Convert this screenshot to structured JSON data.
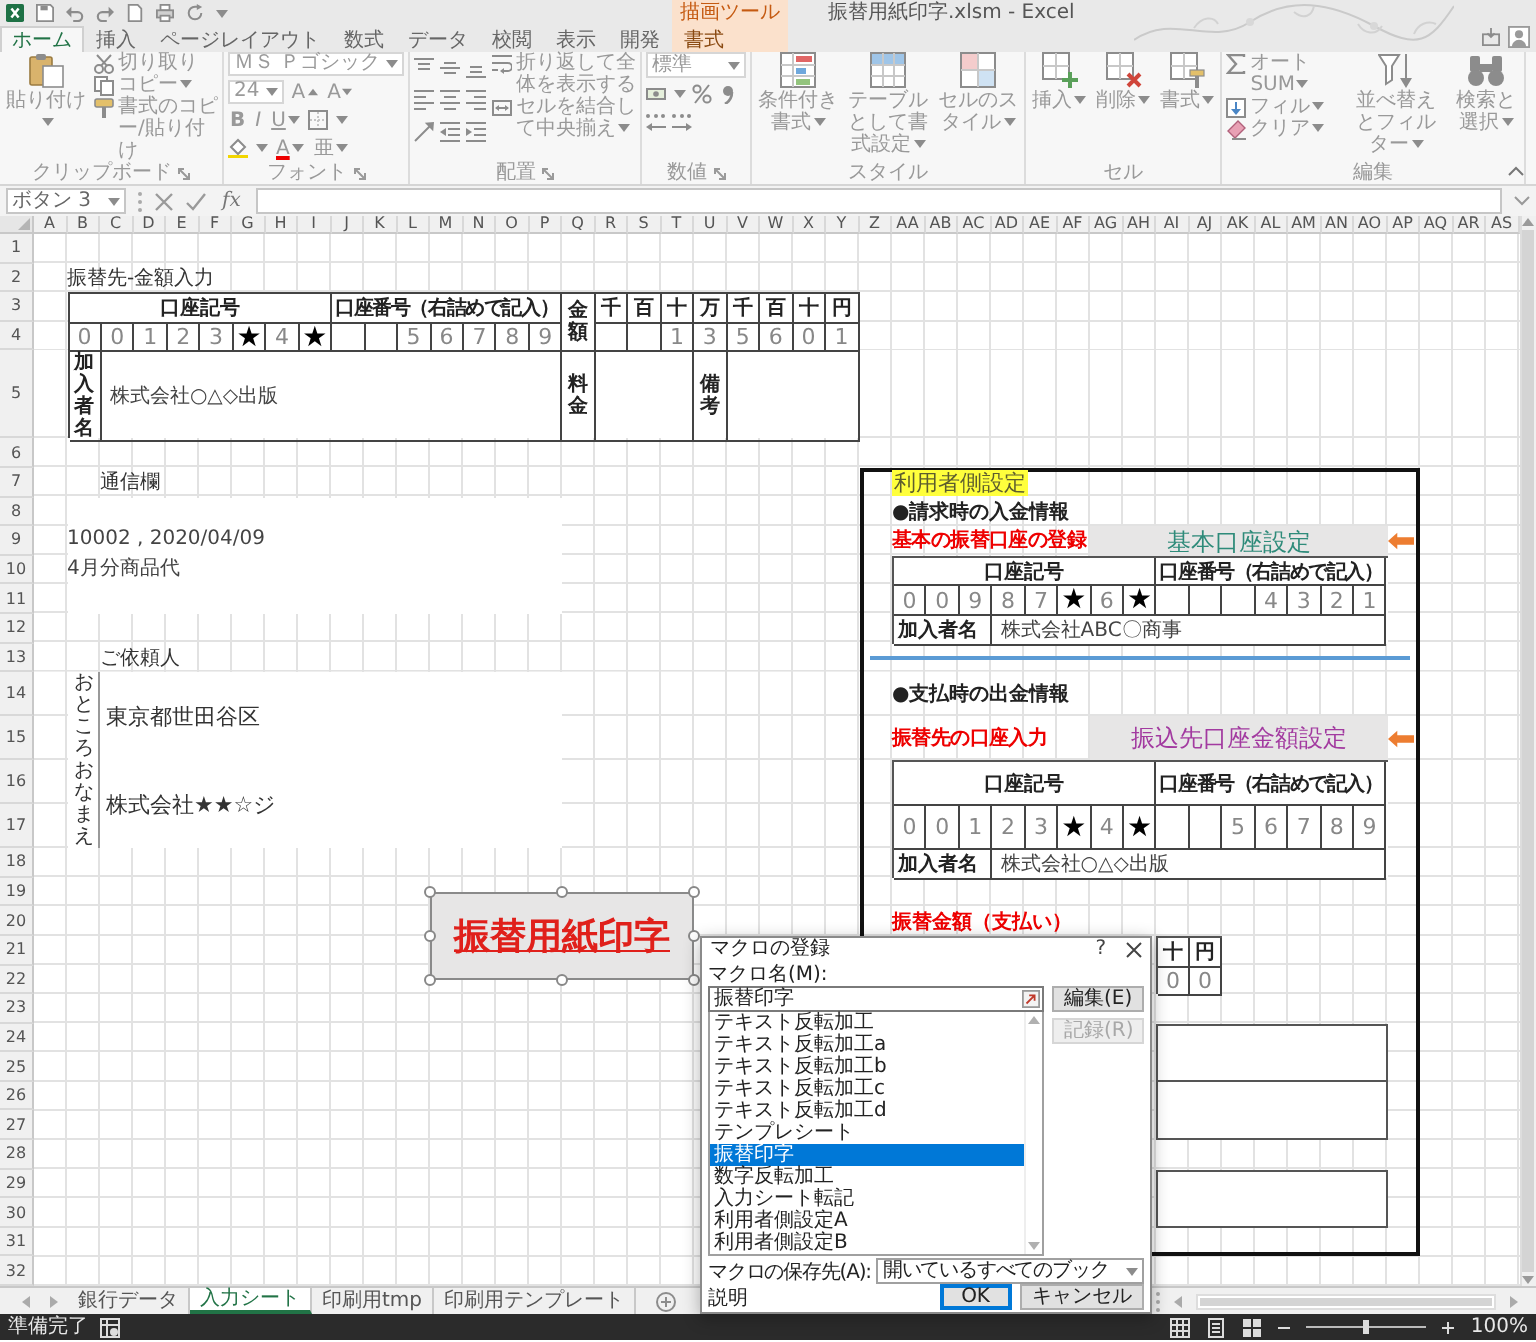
{
  "title_bar": {
    "title": "振替用紙印字.xlsm - Excel"
  },
  "ribbon_tabs": [
    {
      "label": "ホーム",
      "selected": true
    },
    {
      "label": "挿入",
      "selected": false
    },
    {
      "label": "ページレイアウト",
      "selected": false
    },
    {
      "label": "数式",
      "selected": false
    },
    {
      "label": "データ",
      "selected": false
    },
    {
      "label": "校閲",
      "selected": false
    },
    {
      "label": "表示",
      "selected": false
    },
    {
      "label": "開発",
      "selected": false
    }
  ],
  "context_tabs": {
    "group_label": "描画ツール",
    "tabs": [
      {
        "label": "書式",
        "selected": false
      }
    ]
  },
  "ribbon": {
    "clipboard": {
      "label": "クリップボード",
      "paste": "貼り付け",
      "cut": "切り取り",
      "copy": "コピー",
      "format_painter": "書式のコピー/貼り付け"
    },
    "font": {
      "label": "フォント",
      "font_name": "ＭＳ Ｐゴシック",
      "font_size": "24",
      "grow": "A",
      "shrink": "A",
      "bold": "B",
      "italic": "I",
      "underline": "U",
      "font_color": "A",
      "phonetic": "亜"
    },
    "alignment": {
      "label": "配置",
      "wrap_text": "折り返して全体を表示する",
      "merge_center": "セルを結合して中央揃え"
    },
    "number": {
      "label": "数値",
      "format": "標準"
    },
    "styles": {
      "label": "スタイル",
      "conditional": "条件付き書式",
      "as_table": "テーブルとして書式設定",
      "cell_styles": "セルのスタイル"
    },
    "cells": {
      "label": "セル",
      "insert": "挿入",
      "delete": "削除",
      "format": "書式"
    },
    "editing": {
      "label": "編集",
      "autosum": "オート SUM",
      "fill": "フィル",
      "clear": "クリア",
      "sort_filter": "並べ替えとフィルター",
      "find_select": "検索と選択"
    }
  },
  "formula_bar": {
    "name_box": "ボタン 3",
    "function_button": "fx"
  },
  "sheet": {
    "columns": [
      "A",
      "B",
      "C",
      "D",
      "E",
      "F",
      "G",
      "H",
      "I",
      "J",
      "K",
      "L",
      "M",
      "N",
      "O",
      "P",
      "Q",
      "R",
      "S",
      "T",
      "U",
      "V",
      "W",
      "X",
      "Y",
      "Z",
      "AA",
      "AB",
      "AC",
      "AD",
      "AE",
      "AF",
      "AG",
      "AH",
      "AI",
      "AJ",
      "AK",
      "AL",
      "AM",
      "AN",
      "AO",
      "AP",
      "AQ",
      "AR",
      "AS"
    ],
    "rows": [
      "1",
      "2",
      "3",
      "4",
      "5",
      "6",
      "7",
      "8",
      "9",
      "10",
      "11",
      "12",
      "13",
      "14",
      "15",
      "16",
      "17",
      "18",
      "19",
      "20",
      "21",
      "22",
      "23",
      "24",
      "25",
      "26",
      "27",
      "28",
      "29",
      "30",
      "31",
      "32"
    ]
  },
  "transfer_form": {
    "heading": "振替先‐金額入力",
    "symbol_label": "口座記号",
    "number_label": "口座番号（右詰めで記入）",
    "amount_label": "金額",
    "units": [
      "千",
      "百",
      "十",
      "万",
      "千",
      "百",
      "十",
      "円"
    ],
    "symbol_digits": [
      {
        "text": "0",
        "kind": "digit"
      },
      {
        "text": "0",
        "kind": "digit"
      },
      {
        "text": "1",
        "kind": "digit"
      },
      {
        "text": "2",
        "kind": "digit"
      },
      {
        "text": "3",
        "kind": "digit"
      },
      {
        "text": "★",
        "kind": "star"
      },
      {
        "text": "4",
        "kind": "digit"
      },
      {
        "text": "★",
        "kind": "star"
      }
    ],
    "number_digits": [
      "5",
      "6",
      "7",
      "8",
      "9"
    ],
    "amount_digits": [
      "1",
      "3",
      "5",
      "6",
      "0",
      "1"
    ],
    "payer_label": "加入者名",
    "payer_name": "株式会社○△◇出版",
    "fee_label": "料金",
    "remarks_label": "備考"
  },
  "message": {
    "label": "通信欄",
    "lines": [
      "10002 , 2020/04/09",
      "4月分商品代"
    ]
  },
  "requester": {
    "label": "ご依頼人",
    "address_label": "おところ",
    "name_label": "おなまえ",
    "address": "東京都世田谷区",
    "name": "株式会社★★☆ジ"
  },
  "shape_button": {
    "label": "振替用紙印字",
    "selected": true
  },
  "user_settings": {
    "title": "利用者側設定",
    "sections": [
      {
        "heading": "●請求時の入金情報",
        "label": "基本の振替口座の登録",
        "button": "基本口座設定",
        "symbol_label": "口座記号",
        "number_label": "口座番号（右詰めで記入）",
        "symbol_digits": [
          {
            "text": "0",
            "kind": "digit"
          },
          {
            "text": "0",
            "kind": "digit"
          },
          {
            "text": "9",
            "kind": "digit"
          },
          {
            "text": "8",
            "kind": "digit"
          },
          {
            "text": "7",
            "kind": "digit"
          },
          {
            "text": "★",
            "kind": "star"
          },
          {
            "text": "6",
            "kind": "digit"
          },
          {
            "text": "★",
            "kind": "star"
          }
        ],
        "number_digits": [
          "4",
          "3",
          "2",
          "1"
        ],
        "payer_label": "加入者名",
        "payer_name": "株式会社ABC〇商事"
      },
      {
        "heading": "●支払時の出金情報",
        "label": "振替先の口座入力",
        "button": "振込先口座金額設定",
        "symbol_label": "口座記号",
        "number_label": "口座番号（右詰めで記入）",
        "symbol_digits": [
          {
            "text": "0",
            "kind": "digit"
          },
          {
            "text": "0",
            "kind": "digit"
          },
          {
            "text": "1",
            "kind": "digit"
          },
          {
            "text": "2",
            "kind": "digit"
          },
          {
            "text": "3",
            "kind": "digit"
          },
          {
            "text": "★",
            "kind": "star"
          },
          {
            "text": "4",
            "kind": "digit"
          },
          {
            "text": "★",
            "kind": "star"
          }
        ],
        "number_digits": [
          "5",
          "6",
          "7",
          "8",
          "9"
        ],
        "payer_label": "加入者名",
        "payer_name": "株式会社○△◇出版"
      }
    ],
    "amount": {
      "label": "振替金額（支払い）",
      "units": [
        "十",
        "円"
      ],
      "digits": [
        "0",
        "0"
      ]
    }
  },
  "macro_dialog": {
    "title": "マクロの登録",
    "help": "?",
    "name_label": "マクロ名(M):",
    "name_value": "振替印字",
    "macros": [
      {
        "name": "テキスト反転加工",
        "selected": false
      },
      {
        "name": "テキスト反転加工a",
        "selected": false
      },
      {
        "name": "テキスト反転加工b",
        "selected": false
      },
      {
        "name": "テキスト反転加工c",
        "selected": false
      },
      {
        "name": "テキスト反転加工d",
        "selected": false
      },
      {
        "name": "テンプレシート",
        "selected": false
      },
      {
        "name": "振替印字",
        "selected": true
      },
      {
        "name": "数字反転加工",
        "selected": false
      },
      {
        "name": "入力シート転記",
        "selected": false
      },
      {
        "name": "利用者側設定A",
        "selected": false
      },
      {
        "name": "利用者側設定B",
        "selected": false
      }
    ],
    "edit_button": "編集(E)",
    "record_button": {
      "label": "記録(R)",
      "disabled": true
    },
    "location_label": "マクロの保存先(A):",
    "location_value": "開いているすべてのブック",
    "description_label": "説明",
    "ok_button": "OK",
    "cancel_button": "キャンセル"
  },
  "sheet_tabs": [
    {
      "label": "銀行データ",
      "selected": false
    },
    {
      "label": "入力シート",
      "selected": true
    },
    {
      "label": "印刷用tmp",
      "selected": false
    },
    {
      "label": "印刷用テンプレート",
      "selected": false
    }
  ],
  "status_bar": {
    "ready": "準備完了",
    "zoom": "100%",
    "zoom_slider": {
      "level": 0.5
    }
  }
}
